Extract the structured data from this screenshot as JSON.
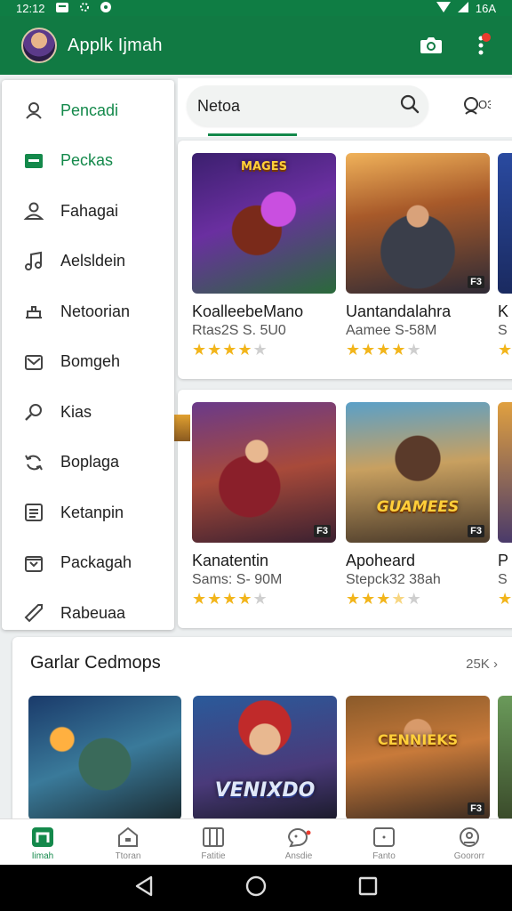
{
  "status_bar": {
    "time": "12:12",
    "battery": "16A"
  },
  "app_bar": {
    "title": "Applk Ijmah",
    "has_notification": true
  },
  "drawer": {
    "items": [
      {
        "label": "Pencadi",
        "icon": "user-circle-icon",
        "active": true
      },
      {
        "label": "Peckas",
        "icon": "folder-icon",
        "active": true
      },
      {
        "label": "Fahagai",
        "icon": "person-icon",
        "active": false
      },
      {
        "label": "Aelsldein",
        "icon": "music-note-icon",
        "active": false
      },
      {
        "label": "Netoorian",
        "icon": "home-icon",
        "active": false
      },
      {
        "label": "Bomgeh",
        "icon": "mail-icon",
        "active": false
      },
      {
        "label": "Kias",
        "icon": "search-icon",
        "active": false
      },
      {
        "label": "Boplaga",
        "icon": "refresh-icon",
        "active": false
      },
      {
        "label": "Ketanpin",
        "icon": "list-icon",
        "active": false
      },
      {
        "label": "Packagah",
        "icon": "inbox-icon",
        "active": false
      },
      {
        "label": "Rabeuaa",
        "icon": "tag-icon",
        "active": false
      }
    ]
  },
  "search": {
    "value": "Netoa",
    "extra_label": "O3"
  },
  "row1": [
    {
      "name": "KoalleebeMano",
      "meta": "Rtas2S S. 5U0",
      "rating": 4,
      "logo": "MAGES",
      "badge": ""
    },
    {
      "name": "Uantandalahra",
      "meta": "Aamee S-58M",
      "rating": 4,
      "logo": "",
      "badge": "F3"
    },
    {
      "name": "K",
      "meta": "S",
      "rating": 1,
      "logo": "",
      "badge": ""
    }
  ],
  "row2": [
    {
      "name": "Kanatentin",
      "meta": "Sams: S- 90M",
      "rating": 4,
      "logo": "",
      "badge": "F3"
    },
    {
      "name": "Apoheard",
      "meta": "Stepck32 38ah",
      "rating": 3.5,
      "logo": "GUAMEES",
      "badge": "F3"
    },
    {
      "name": "P",
      "meta": "S",
      "rating": 1,
      "logo": "",
      "badge": ""
    }
  ],
  "section": {
    "title": "Garlar Cedmops",
    "more": "25K",
    "items": [
      {
        "logo": "",
        "badge": ""
      },
      {
        "logo": "VENIXDO",
        "badge": ""
      },
      {
        "logo": "CENNIEKS",
        "badge": "F3"
      }
    ]
  },
  "bottom_nav": [
    {
      "label": "Ijmah",
      "icon": "home-icon",
      "active": true
    },
    {
      "label": "Ttoran",
      "icon": "store-icon",
      "active": false
    },
    {
      "label": "Fatitie",
      "icon": "book-icon",
      "active": false
    },
    {
      "label": "Ansdie",
      "icon": "chat-icon",
      "active": false
    },
    {
      "label": "Fanto",
      "icon": "tablet-icon",
      "active": false
    },
    {
      "label": "Goororr",
      "icon": "account-icon",
      "active": false
    }
  ],
  "colors": {
    "primary": "#117a43",
    "accent": "#14894b",
    "star": "#f2b51b",
    "notification": "#ea3b2e"
  }
}
